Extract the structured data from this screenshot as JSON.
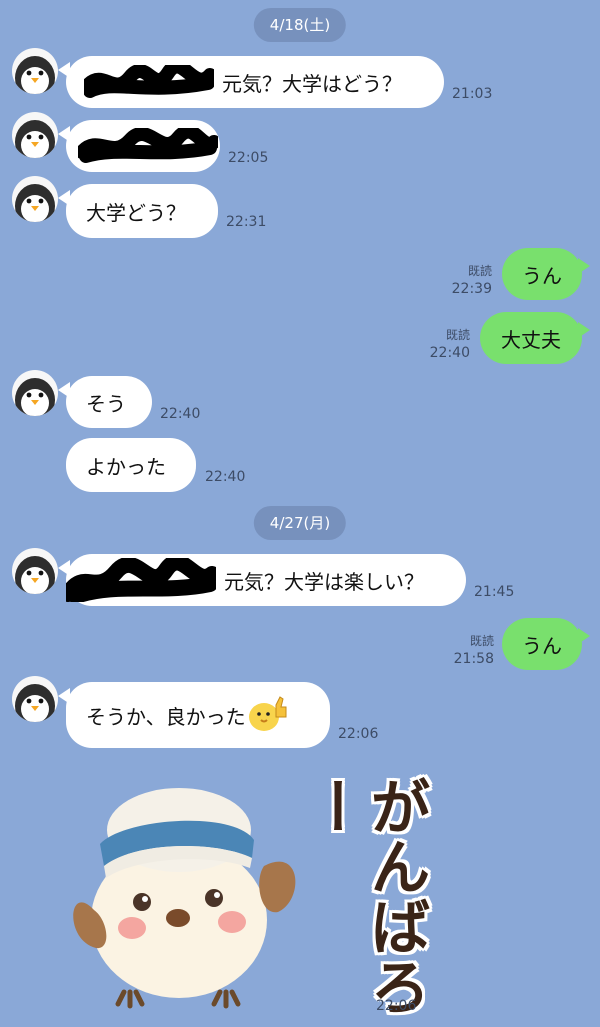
{
  "dates": [
    "4/18(土)",
    "4/27(月)"
  ],
  "read_label": "既読",
  "messages": [
    {
      "text": "元気？大学はどう？",
      "time": "21:03"
    },
    {
      "text": "",
      "time": "22:05"
    },
    {
      "text": "大学どう？",
      "time": "22:31"
    },
    {
      "text": "うん",
      "time": "22:39"
    },
    {
      "text": "大丈夫",
      "time": "22:40"
    },
    {
      "text": "そう",
      "time": "22:40"
    },
    {
      "text": "よかった",
      "time": "22:40"
    },
    {
      "text": "元気？大学は楽しい？",
      "time": "21:45"
    },
    {
      "text": "うん",
      "time": "21:58"
    },
    {
      "text": "そうか、良かった",
      "time": "22:06"
    },
    {
      "text": "",
      "time": "22:06"
    }
  ],
  "sticker": {
    "text": "がんばろー"
  }
}
